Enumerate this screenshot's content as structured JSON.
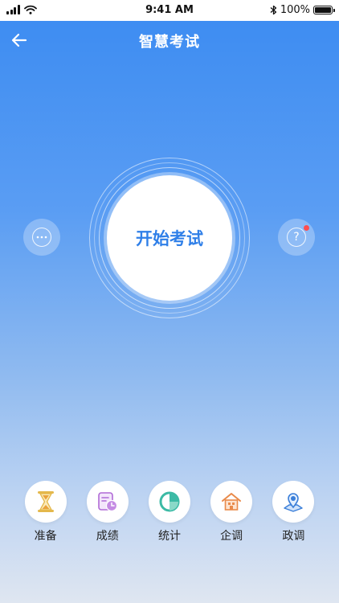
{
  "status_bar": {
    "time": "9:41 AM",
    "battery": "100%",
    "battery_level": 1.0
  },
  "header": {
    "title": "智慧考试"
  },
  "main": {
    "start_button_label": "开始考试",
    "chat_icon": "chat-bubble-icon",
    "help_icon": "question-icon",
    "help_has_notification": true
  },
  "menu": {
    "items": [
      {
        "label": "准备",
        "icon": "hourglass-icon"
      },
      {
        "label": "成绩",
        "icon": "calendar-clock-icon"
      },
      {
        "label": "统计",
        "icon": "pie-chart-icon"
      },
      {
        "label": "企调",
        "icon": "house-icon"
      },
      {
        "label": "政调",
        "icon": "location-badge-icon"
      }
    ]
  },
  "colors": {
    "primary": "#2f7fe8",
    "gradient_top": "#3b8bf2",
    "gradient_bottom": "#dfe6f1",
    "notification": "#ff4d4f"
  }
}
